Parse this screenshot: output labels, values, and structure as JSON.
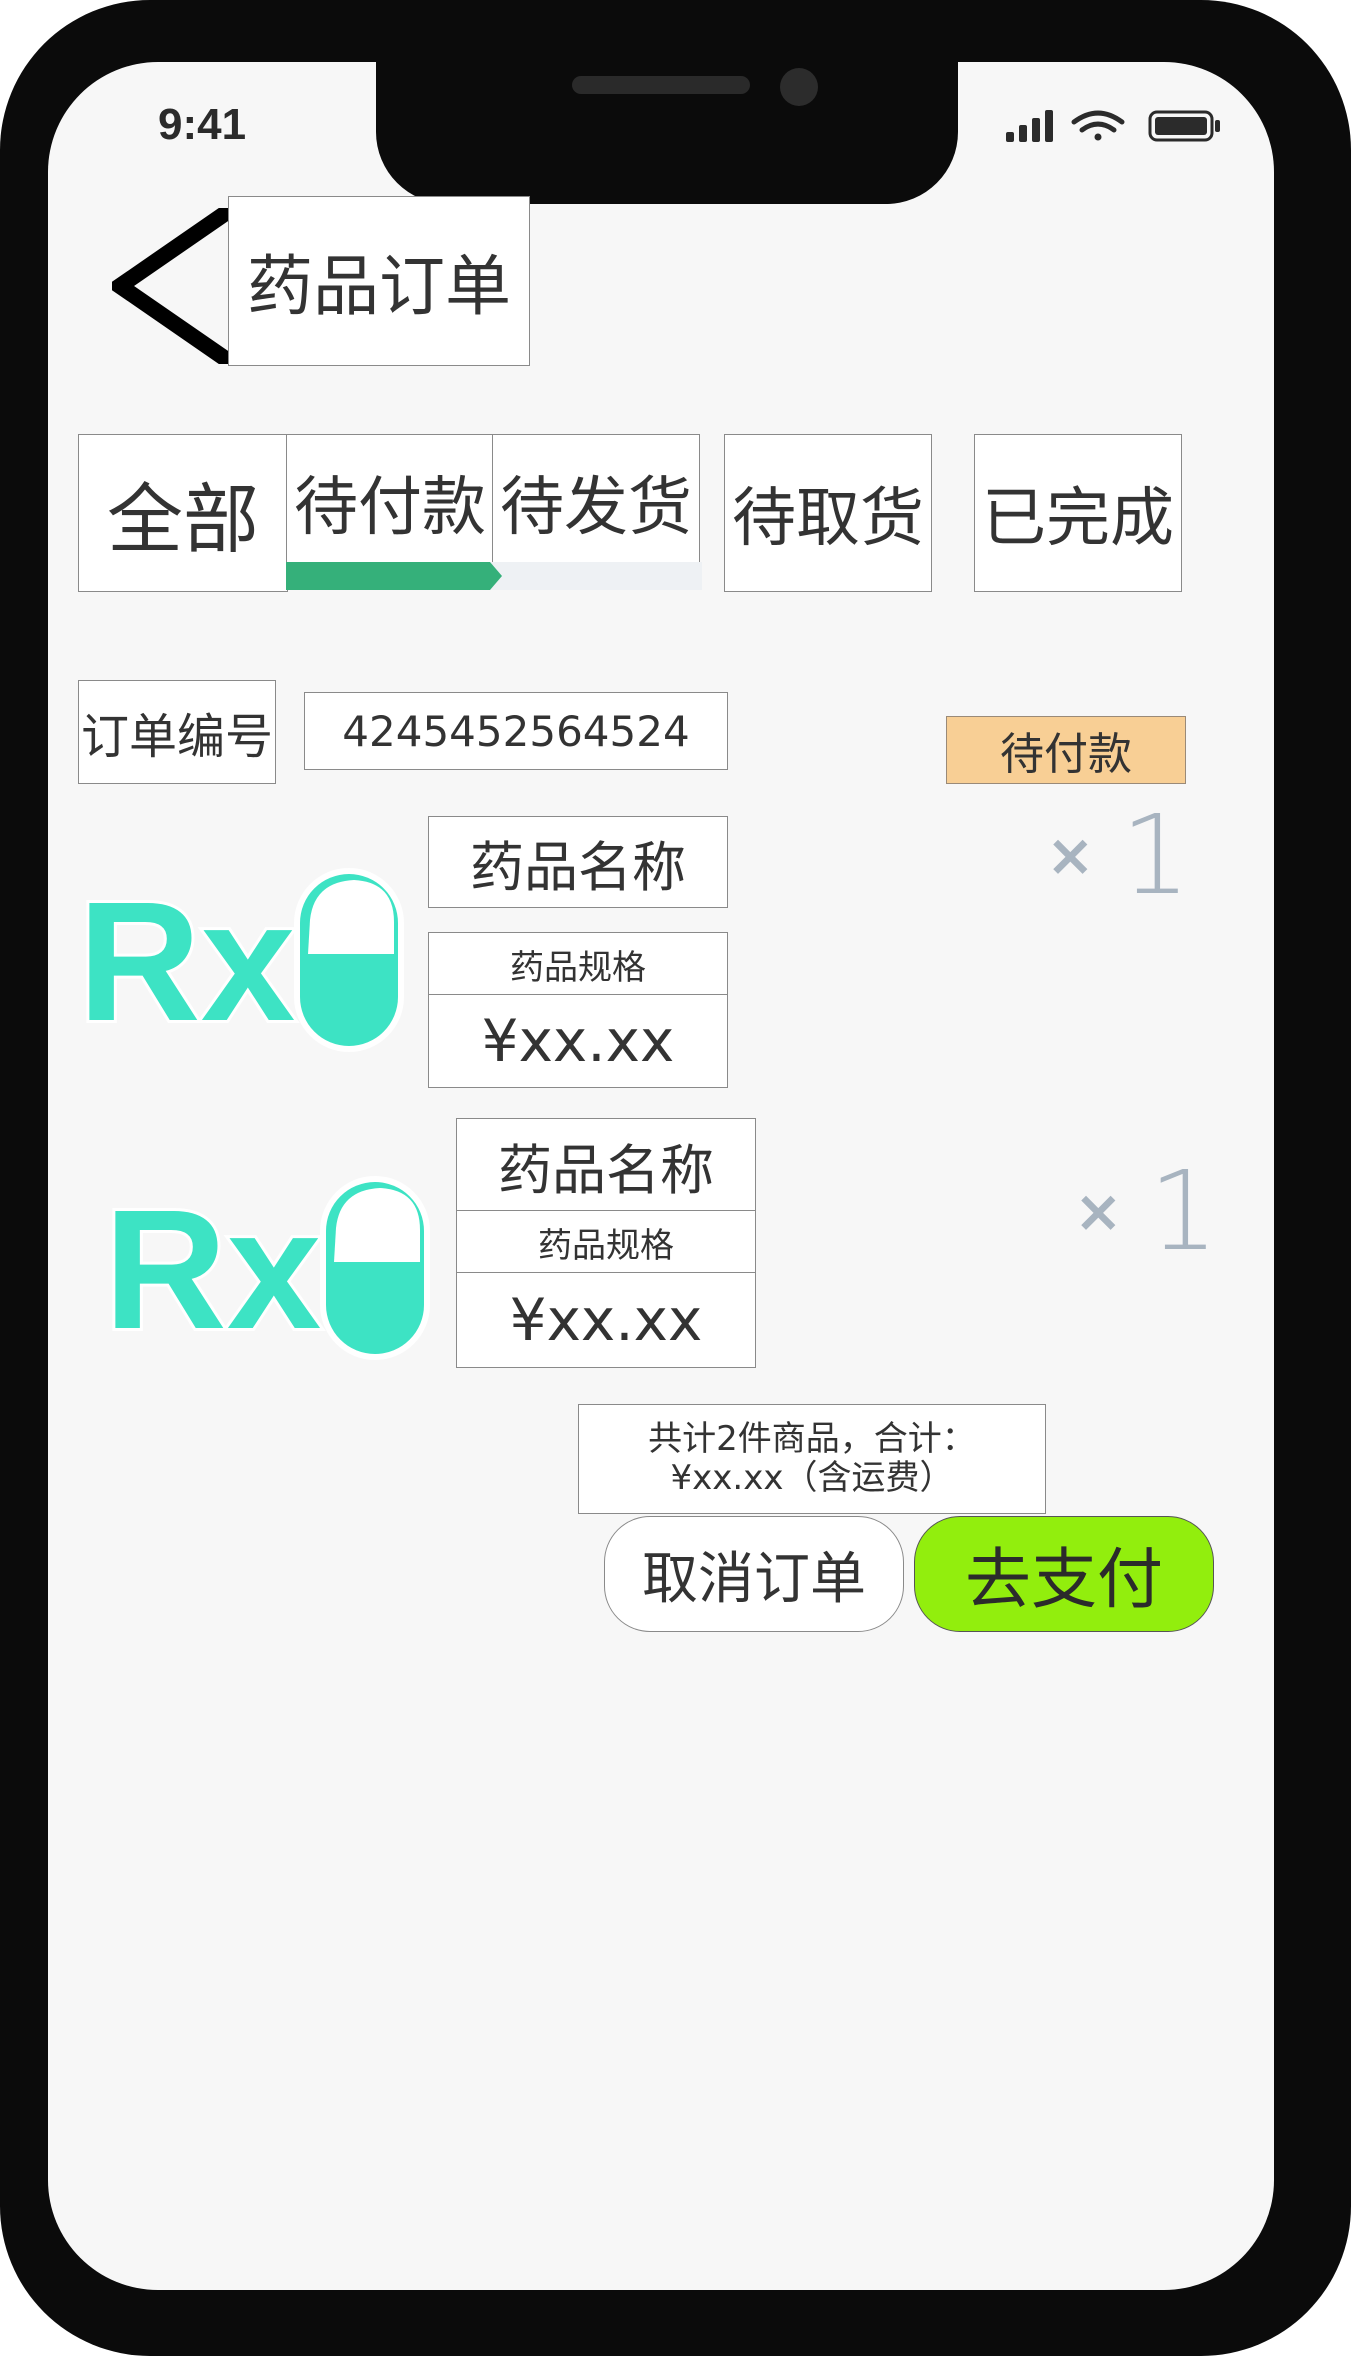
{
  "status_bar": {
    "time": "9:41"
  },
  "header": {
    "title": "药品订单",
    "back_icon": "back-arrow-icon"
  },
  "tabs": [
    {
      "label": "全部"
    },
    {
      "label": "待付款",
      "active": true
    },
    {
      "label": "待发货"
    },
    {
      "label": "待取货"
    },
    {
      "label": "已完成"
    }
  ],
  "order": {
    "number_label": "订单编号",
    "number_value": "4245452564524",
    "status": "待付款",
    "items": [
      {
        "name": "药品名称",
        "spec": "药品规格",
        "price": "¥xx.xx",
        "qty_symbol": "×",
        "qty": "1",
        "image_icon": "rx-capsule-icon"
      },
      {
        "name": "药品名称",
        "spec": "药品规格",
        "price": "¥xx.xx",
        "qty_symbol": "×",
        "qty": "1",
        "image_icon": "rx-capsule-icon"
      }
    ],
    "summary_line1": "共计2件商品，合计：",
    "summary_line2": "¥xx.xx（含运费）",
    "cancel_label": "取消订单",
    "pay_label": "去支付"
  },
  "colors": {
    "tab_progress": "#35b07a",
    "status_badge": "#f8cf95",
    "pay_button": "#92ee0d",
    "rx_logo": "#3de3c4",
    "qty_text": "#a8b4c0"
  }
}
